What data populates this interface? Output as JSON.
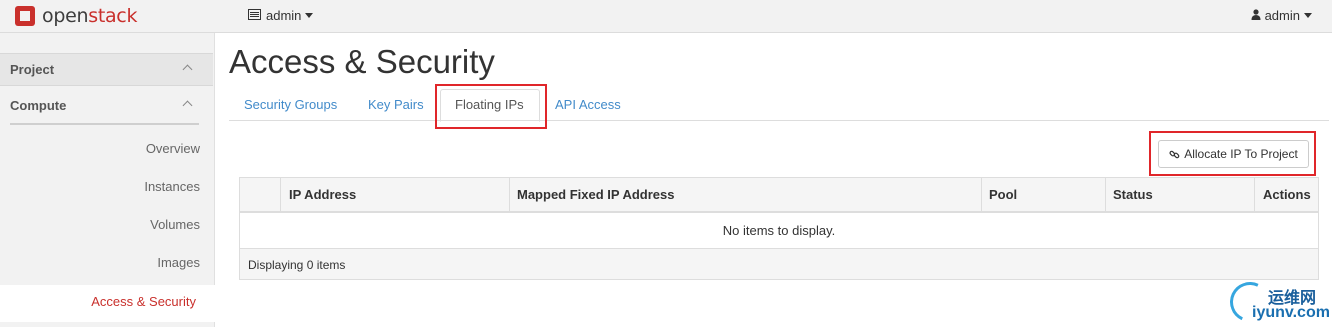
{
  "navbar": {
    "brand_prefix": "open",
    "brand_suffix": "stack",
    "project_selector": "admin",
    "user_menu": "admin"
  },
  "sidebar": {
    "dashboard": "Project",
    "panel_group": "Compute",
    "items": [
      {
        "label": "Overview"
      },
      {
        "label": "Instances"
      },
      {
        "label": "Volumes"
      },
      {
        "label": "Images"
      },
      {
        "label": "Access & Security",
        "active": true
      }
    ]
  },
  "main": {
    "title": "Access & Security",
    "tabs": [
      {
        "label": "Security Groups"
      },
      {
        "label": "Key Pairs"
      },
      {
        "label": "Floating IPs",
        "active": true
      },
      {
        "label": "API Access"
      }
    ],
    "actions": {
      "allocate_label": "Allocate IP To Project"
    },
    "table": {
      "columns": [
        "IP Address",
        "Mapped Fixed IP Address",
        "Pool",
        "Status",
        "Actions"
      ],
      "empty_message": "No items to display.",
      "footer": "Displaying 0 items"
    }
  },
  "watermark": {
    "text_cn": "运维网",
    "url": "iyunv.com"
  },
  "colors": {
    "accent": "#c9302c",
    "link": "#428bca",
    "highlight": "#e0262a"
  }
}
